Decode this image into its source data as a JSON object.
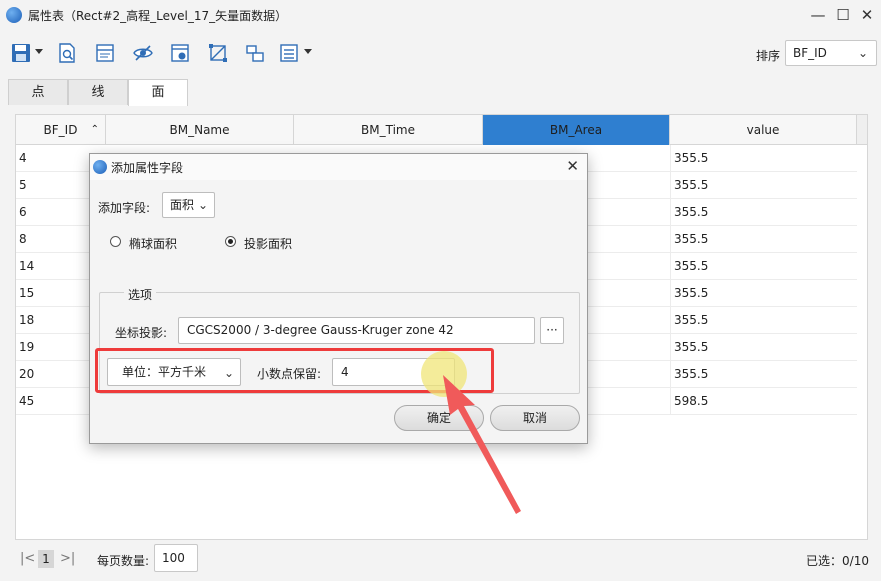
{
  "window": {
    "title": "属性表（Rect#2_高程_Level_17_矢量面数据）"
  },
  "toolbar": {
    "icons": [
      "save-icon",
      "zoom-to-icon",
      "filter-table-icon",
      "hide-field-icon",
      "field-properties-icon",
      "select-shape-icon",
      "copy-layout-icon",
      "table-options-icon"
    ],
    "sort_label": "排序",
    "sort_value": "BF_ID"
  },
  "tabs": [
    {
      "label": "点"
    },
    {
      "label": "线"
    },
    {
      "label": "面",
      "active": true
    }
  ],
  "table": {
    "columns": [
      "BF_ID",
      "BM_Name",
      "BM_Time",
      "BM_Area",
      "value"
    ],
    "selected_column": "BM_Area",
    "rows": [
      {
        "BF_ID": "4",
        "value": "355.5"
      },
      {
        "BF_ID": "5",
        "value": "355.5"
      },
      {
        "BF_ID": "6",
        "value": "355.5"
      },
      {
        "BF_ID": "8",
        "value": "355.5"
      },
      {
        "BF_ID": "14",
        "value": "355.5"
      },
      {
        "BF_ID": "15",
        "value": "355.5"
      },
      {
        "BF_ID": "18",
        "value": "355.5"
      },
      {
        "BF_ID": "19",
        "value": "355.5"
      },
      {
        "BF_ID": "20",
        "value": "355.5"
      },
      {
        "BF_ID": "45",
        "value": "598.5"
      }
    ]
  },
  "footer": {
    "current_page": "1",
    "per_page_label": "每页数量:",
    "per_page_value": "100",
    "selected_count": "已选：0/10"
  },
  "dialog": {
    "title": "添加属性字段",
    "add_field_label": "添加字段:",
    "add_field_value": "面积",
    "radio_ellipsoid": "椭球面积",
    "radio_projected": "投影面积",
    "selected_radio": "投影面积",
    "options_group": "选项",
    "projection_label": "坐标投影:",
    "projection_value": "CGCS2000 / 3-degree Gauss-Kruger zone 42",
    "browse_label": "···",
    "unit_value": "单位：平方千米",
    "decimal_label": "小数点保留:",
    "decimal_value": "4",
    "ok_label": "确定",
    "cancel_label": "取消"
  },
  "colors": {
    "highlight": "#ee3b3b",
    "selected_column": "#2f7fd0",
    "annotation_arrow": "#f05a5a"
  }
}
